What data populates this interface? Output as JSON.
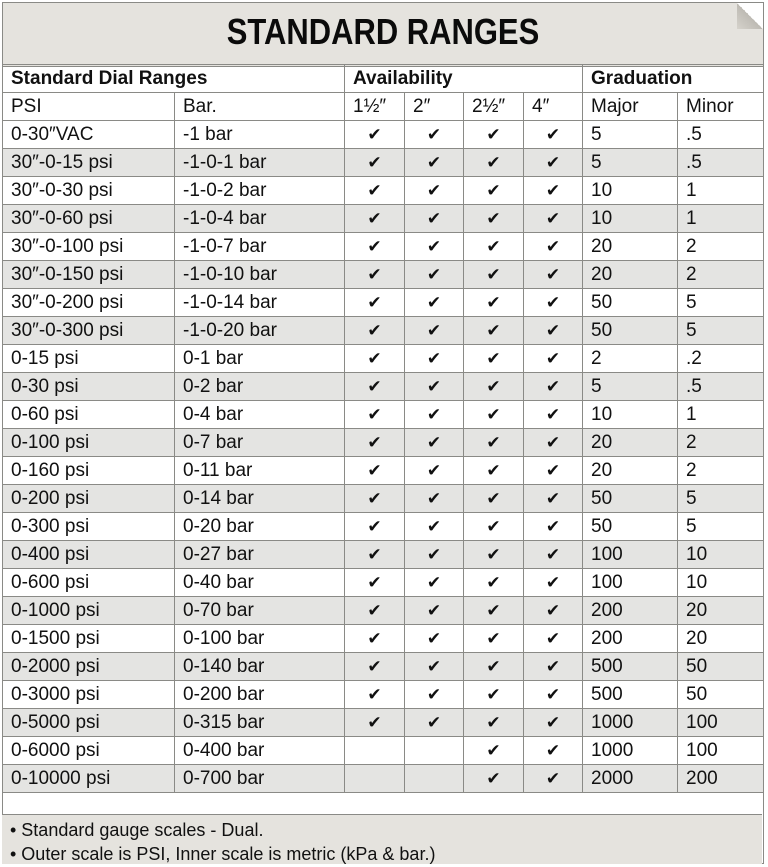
{
  "title": "STANDARD RANGES",
  "group_headers": {
    "dial": "Standard Dial Ranges",
    "availability": "Availability",
    "graduation": "Graduation"
  },
  "columns": [
    "PSI",
    "Bar.",
    "1½″",
    "2″",
    "2½″",
    "4″",
    "Major",
    "Minor"
  ],
  "check_glyph": "✔",
  "rows": [
    {
      "psi": "0-30″VAC",
      "bar": "-1 bar",
      "a": [
        true,
        true,
        true,
        true
      ],
      "major": "5",
      "minor": ".5"
    },
    {
      "psi": "30″-0-15 psi",
      "bar": "-1-0-1 bar",
      "a": [
        true,
        true,
        true,
        true
      ],
      "major": "5",
      "minor": ".5"
    },
    {
      "psi": "30″-0-30 psi",
      "bar": "-1-0-2 bar",
      "a": [
        true,
        true,
        true,
        true
      ],
      "major": "10",
      "minor": "1"
    },
    {
      "psi": "30″-0-60 psi",
      "bar": "-1-0-4 bar",
      "a": [
        true,
        true,
        true,
        true
      ],
      "major": "10",
      "minor": "1"
    },
    {
      "psi": "30″-0-100 psi",
      "bar": "-1-0-7 bar",
      "a": [
        true,
        true,
        true,
        true
      ],
      "major": "20",
      "minor": "2"
    },
    {
      "psi": "30″-0-150 psi",
      "bar": "-1-0-10 bar",
      "a": [
        true,
        true,
        true,
        true
      ],
      "major": "20",
      "minor": "2"
    },
    {
      "psi": "30″-0-200 psi",
      "bar": "-1-0-14 bar",
      "a": [
        true,
        true,
        true,
        true
      ],
      "major": "50",
      "minor": "5"
    },
    {
      "psi": "30″-0-300 psi",
      "bar": "-1-0-20 bar",
      "a": [
        true,
        true,
        true,
        true
      ],
      "major": "50",
      "minor": "5"
    },
    {
      "psi": "0-15 psi",
      "bar": "0-1 bar",
      "a": [
        true,
        true,
        true,
        true
      ],
      "major": "2",
      "minor": ".2"
    },
    {
      "psi": "0-30 psi",
      "bar": "0-2 bar",
      "a": [
        true,
        true,
        true,
        true
      ],
      "major": "5",
      "minor": ".5"
    },
    {
      "psi": "0-60 psi",
      "bar": "0-4 bar",
      "a": [
        true,
        true,
        true,
        true
      ],
      "major": "10",
      "minor": "1"
    },
    {
      "psi": "0-100 psi",
      "bar": "0-7 bar",
      "a": [
        true,
        true,
        true,
        true
      ],
      "major": "20",
      "minor": "2"
    },
    {
      "psi": "0-160 psi",
      "bar": "0-11 bar",
      "a": [
        true,
        true,
        true,
        true
      ],
      "major": "20",
      "minor": "2"
    },
    {
      "psi": "0-200 psi",
      "bar": "0-14 bar",
      "a": [
        true,
        true,
        true,
        true
      ],
      "major": "50",
      "minor": "5"
    },
    {
      "psi": "0-300 psi",
      "bar": "0-20 bar",
      "a": [
        true,
        true,
        true,
        true
      ],
      "major": "50",
      "minor": "5"
    },
    {
      "psi": "0-400 psi",
      "bar": "0-27 bar",
      "a": [
        true,
        true,
        true,
        true
      ],
      "major": "100",
      "minor": "10"
    },
    {
      "psi": "0-600 psi",
      "bar": "0-40 bar",
      "a": [
        true,
        true,
        true,
        true
      ],
      "major": "100",
      "minor": "10"
    },
    {
      "psi": "0-1000 psi",
      "bar": "0-70 bar",
      "a": [
        true,
        true,
        true,
        true
      ],
      "major": "200",
      "minor": "20"
    },
    {
      "psi": "0-1500 psi",
      "bar": "0-100 bar",
      "a": [
        true,
        true,
        true,
        true
      ],
      "major": "200",
      "minor": "20"
    },
    {
      "psi": "0-2000 psi",
      "bar": "0-140 bar",
      "a": [
        true,
        true,
        true,
        true
      ],
      "major": "500",
      "minor": "50"
    },
    {
      "psi": "0-3000 psi",
      "bar": "0-200 bar",
      "a": [
        true,
        true,
        true,
        true
      ],
      "major": "500",
      "minor": "50"
    },
    {
      "psi": "0-5000 psi",
      "bar": "0-315 bar",
      "a": [
        true,
        true,
        true,
        true
      ],
      "major": "1000",
      "minor": "100"
    },
    {
      "psi": "0-6000 psi",
      "bar": "0-400 bar",
      "a": [
        false,
        false,
        true,
        true
      ],
      "major": "1000",
      "minor": "100"
    },
    {
      "psi": "0-10000 psi",
      "bar": "0-700 bar",
      "a": [
        false,
        false,
        true,
        true
      ],
      "major": "2000",
      "minor": "200"
    }
  ],
  "notes": [
    "• Standard gauge scales - Dual.",
    "• Outer scale is PSI,  Inner scale is metric (kPa & bar.)"
  ],
  "colors": {
    "header_bg": "#e5e3de",
    "row_shade": "#e4e4e2",
    "border": "#8a8a86"
  }
}
